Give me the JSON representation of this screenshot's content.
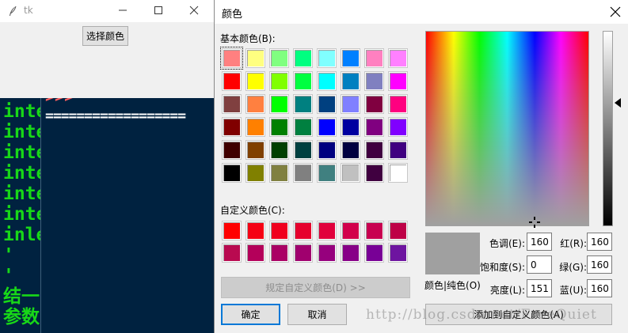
{
  "tk_window": {
    "title": "tk",
    "button_label": "选择颜色",
    "minimize_glyph": "—",
    "maximize_glyph": "☐",
    "close_glyph": "✕"
  },
  "terminal": {
    "left_lines": [
      "inte",
      "inte",
      "inte",
      "inte",
      "inte",
      "inte",
      "inle",
      "'",
      "'",
      "结一",
      "参数"
    ],
    "prompt_fragment": ">>>",
    "separator": "=================="
  },
  "color_dialog": {
    "title": "颜色",
    "close_glyph": "✕",
    "basic_colors_label": "基本颜色(B):",
    "basic_colors": [
      "#ff8080",
      "#ffff80",
      "#80ff80",
      "#00ff80",
      "#80ffff",
      "#0080ff",
      "#ff80c0",
      "#ff80ff",
      "#ff0000",
      "#ffff00",
      "#80ff00",
      "#00ff40",
      "#00ffff",
      "#0080c0",
      "#8080c0",
      "#ff00ff",
      "#804040",
      "#ff8040",
      "#00ff00",
      "#008080",
      "#004080",
      "#8080ff",
      "#800040",
      "#ff0080",
      "#800000",
      "#ff8000",
      "#008000",
      "#008040",
      "#0000ff",
      "#0000a0",
      "#800080",
      "#8000ff",
      "#400000",
      "#804000",
      "#004000",
      "#004040",
      "#000080",
      "#000040",
      "#400040",
      "#400080",
      "#000000",
      "#808000",
      "#808040",
      "#808080",
      "#408080",
      "#c0c0c0",
      "#400040",
      "#ffffff"
    ],
    "custom_colors_label": "自定义颜色(C):",
    "custom_colors": [
      "#ff0000",
      "#f50014",
      "#f0001e",
      "#e6002d",
      "#e1003c",
      "#d2004b",
      "#c80050",
      "#be0046",
      "#b90a50",
      "#b4005a",
      "#aa0064",
      "#a0006e",
      "#96007d",
      "#870087",
      "#780096",
      "#6e14a0"
    ],
    "define_custom_button": "规定自定义颜色(D) >>",
    "ok_button": "确定",
    "cancel_button": "取消",
    "add_custom_button": "添加到自定义颜色(A)",
    "preview_label": "颜色|纯色(O)",
    "preview_color": "#a0a0a0",
    "fields": {
      "hue": {
        "label": "色调(E):",
        "value": "160"
      },
      "saturation": {
        "label": "饱和度(S):",
        "value": "0"
      },
      "luminance": {
        "label": "亮度(L):",
        "value": "151"
      },
      "red": {
        "label": "红(R):",
        "value": "160"
      },
      "green": {
        "label": "绿(G):",
        "value": "160"
      },
      "blue": {
        "label": "蓝(U):",
        "value": "160"
      }
    }
  },
  "watermark": "http://blog.csdn.net/FreeQuiet"
}
